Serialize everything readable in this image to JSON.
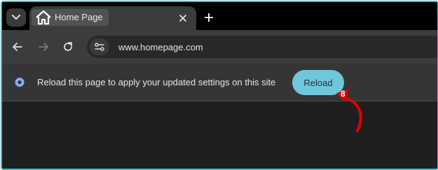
{
  "tab": {
    "title": "Home Page",
    "favicon": "home-icon"
  },
  "toolbar": {
    "url": "www.homepage.com"
  },
  "infobar": {
    "message": "Reload this page to apply your updated settings on this site",
    "button_label": "Reload",
    "icon": "gear-icon"
  },
  "annotation": {
    "step_number": "8",
    "arrow_color": "#e00000"
  },
  "colors": {
    "accent_border": "#2ec4c9",
    "reload_button": "#6fc7dc"
  }
}
